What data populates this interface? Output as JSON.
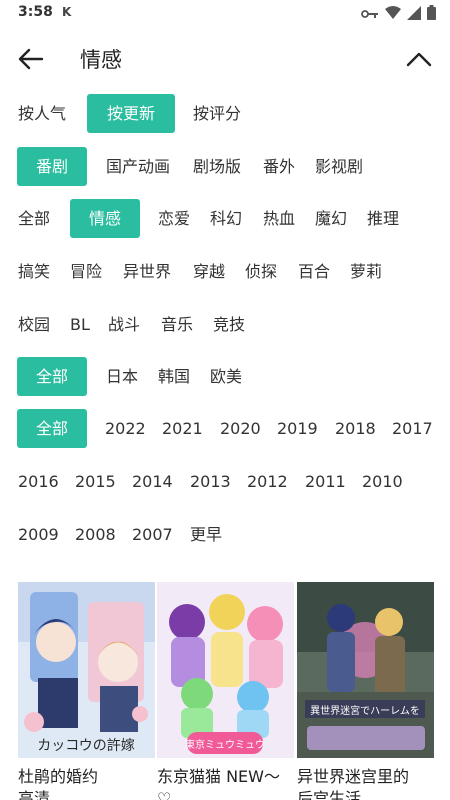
{
  "status_bar": {
    "time": "3:58",
    "k_label": "K"
  },
  "header": {
    "title": "情感"
  },
  "filters": {
    "sort": [
      "按人气",
      "按更新",
      "按评分"
    ],
    "type": [
      "番剧",
      "国产动画",
      "剧场版",
      "番外",
      "影视剧"
    ],
    "genre_row1": [
      "全部",
      "情感",
      "恋爱",
      "科幻",
      "热血",
      "魔幻",
      "推理"
    ],
    "genre_row2": [
      "搞笑",
      "冒险",
      "异世界",
      "穿越",
      "侦探",
      "百合",
      "萝莉"
    ],
    "genre_row3": [
      "校园",
      "BL",
      "战斗",
      "音乐",
      "竞技"
    ],
    "region": [
      "全部",
      "日本",
      "韩国",
      "欧美"
    ],
    "year_row1": [
      "全部",
      "2022",
      "2021",
      "2020",
      "2019",
      "2018",
      "2017"
    ],
    "year_row2": [
      "2016",
      "2015",
      "2014",
      "2013",
      "2012",
      "2011",
      "2010"
    ],
    "year_row3": [
      "2009",
      "2008",
      "2007",
      "更早"
    ],
    "selected": {
      "sort": "按更新",
      "type": "番剧",
      "genre": "情感",
      "region": "全部",
      "year": "全部"
    }
  },
  "cards": [
    {
      "title": "杜鹃的婚约",
      "subtitle": "高清",
      "poster_text": "カッコウの許嫁"
    },
    {
      "title": "东京猫猫 NEW～",
      "subtitle": "♡",
      "poster_text": "東京ミュウミュウ"
    },
    {
      "title": "异世界迷宫里的",
      "subtitle": "后宫生活",
      "poster_text": "異世界迷宮でハーレムを"
    }
  ],
  "colors": {
    "accent": "#2bbd9f",
    "text": "#333333",
    "background": "#ffffff"
  },
  "icons": {
    "back": "arrow-left-icon",
    "collapse": "chevron-up-icon",
    "key": "key-icon",
    "wifi": "wifi-icon",
    "signal": "signal-icon",
    "battery": "battery-icon"
  }
}
